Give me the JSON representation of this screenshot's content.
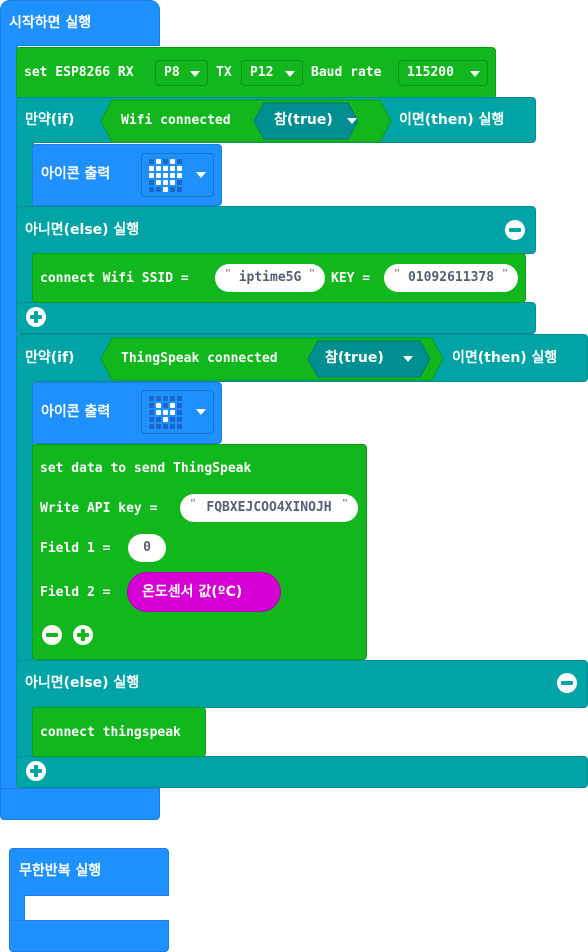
{
  "on_start": {
    "label": "시작하면 실행"
  },
  "set_esp": {
    "prefix": "set ESP8266 RX",
    "rx": "P8",
    "tx_label": "TX",
    "tx": "P12",
    "baud_label": "Baud rate",
    "baud": "115200"
  },
  "if1": {
    "if_label": "만약(if)",
    "condition_label": "Wifi connected",
    "condition_value": "참(true)",
    "then_label": "이면(then) 실행",
    "show_icon_label": "아이콘 출력",
    "else_label": "아니면(else) 실행",
    "connect_prefix": "connect Wifi SSID =",
    "ssid": "iptime5G",
    "key_label": "KEY =",
    "key": "01092611378"
  },
  "if2": {
    "if_label": "만약(if)",
    "condition_label": "ThingSpeak connected",
    "condition_value": "참(true)",
    "then_label": "이면(then) 실행",
    "show_icon_label": "아이콘 출력",
    "set_data_label": "set data to send ThingSpeak",
    "api_label": "Write API key =",
    "api_key": "FQBXEJCOO4XINOJH",
    "field1_label": "Field 1 =",
    "field1_value": "0",
    "field2_label": "Field 2 =",
    "field2_value": "온도센서 값(ºC)",
    "else_label": "아니면(else) 실행",
    "connect_label": "connect thingspeak"
  },
  "forever": {
    "label": "무한반복 실행"
  },
  "colors": {
    "basic": "#1E90FF",
    "esp": "#12B71E",
    "logic": "#00A4A6",
    "input": "#D400D4"
  },
  "icons": {
    "heart": [
      0,
      1,
      0,
      1,
      0,
      1,
      1,
      1,
      1,
      1,
      1,
      1,
      1,
      1,
      1,
      0,
      1,
      1,
      1,
      0,
      0,
      0,
      1,
      0,
      0
    ],
    "small_heart": [
      0,
      0,
      0,
      0,
      0,
      0,
      1,
      0,
      1,
      0,
      0,
      1,
      1,
      1,
      0,
      0,
      0,
      1,
      0,
      0,
      0,
      0,
      0,
      0,
      0
    ]
  }
}
